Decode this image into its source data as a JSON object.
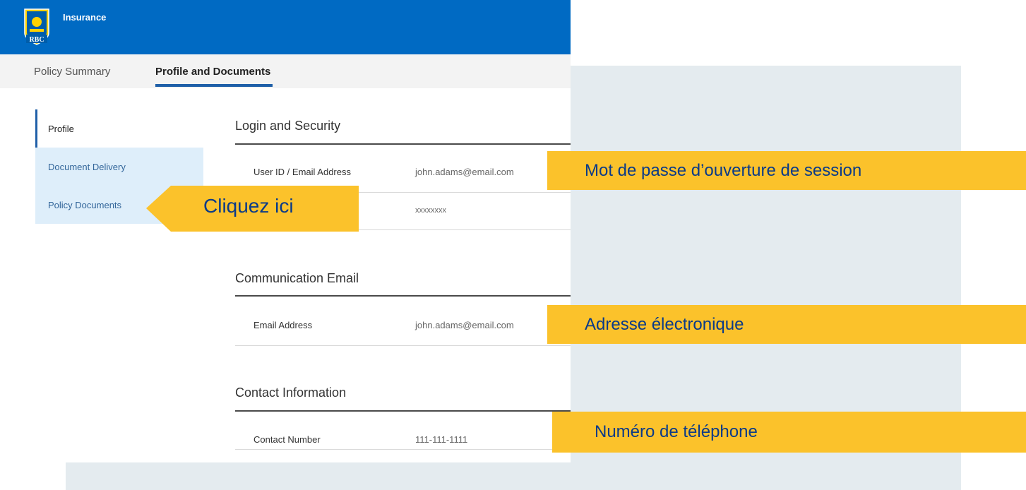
{
  "header": {
    "app_title": "Insurance",
    "logo_text": "RBC",
    "brand_color": "#006ac3"
  },
  "tabs": [
    {
      "label": "Policy Summary",
      "active": false
    },
    {
      "label": "Profile and Documents",
      "active": true
    }
  ],
  "sidebar": {
    "items": [
      {
        "label": "Profile",
        "active": true
      },
      {
        "label": "Document Delivery",
        "active": false
      },
      {
        "label": "Policy Documents",
        "active": false
      }
    ]
  },
  "sections": {
    "login": {
      "title": "Login and Security",
      "rows": [
        {
          "label": "User ID / Email Address",
          "value": "john.adams@email.com"
        },
        {
          "label": "",
          "value": "xxxxxxxx"
        }
      ]
    },
    "communication": {
      "title": "Communication Email",
      "rows": [
        {
          "label": "Email Address",
          "value": "john.adams@email.com"
        }
      ]
    },
    "contact": {
      "title": "Contact Information",
      "rows": [
        {
          "label": "Contact Number",
          "value": "111-111-1111"
        }
      ]
    }
  },
  "annotations": {
    "click_here": "Cliquez ici",
    "login_password": "Mot de passe d’ouverture de session",
    "email": "Adresse électronique",
    "phone": "Numéro de téléphone",
    "highlight_color": "#fbc22b"
  }
}
